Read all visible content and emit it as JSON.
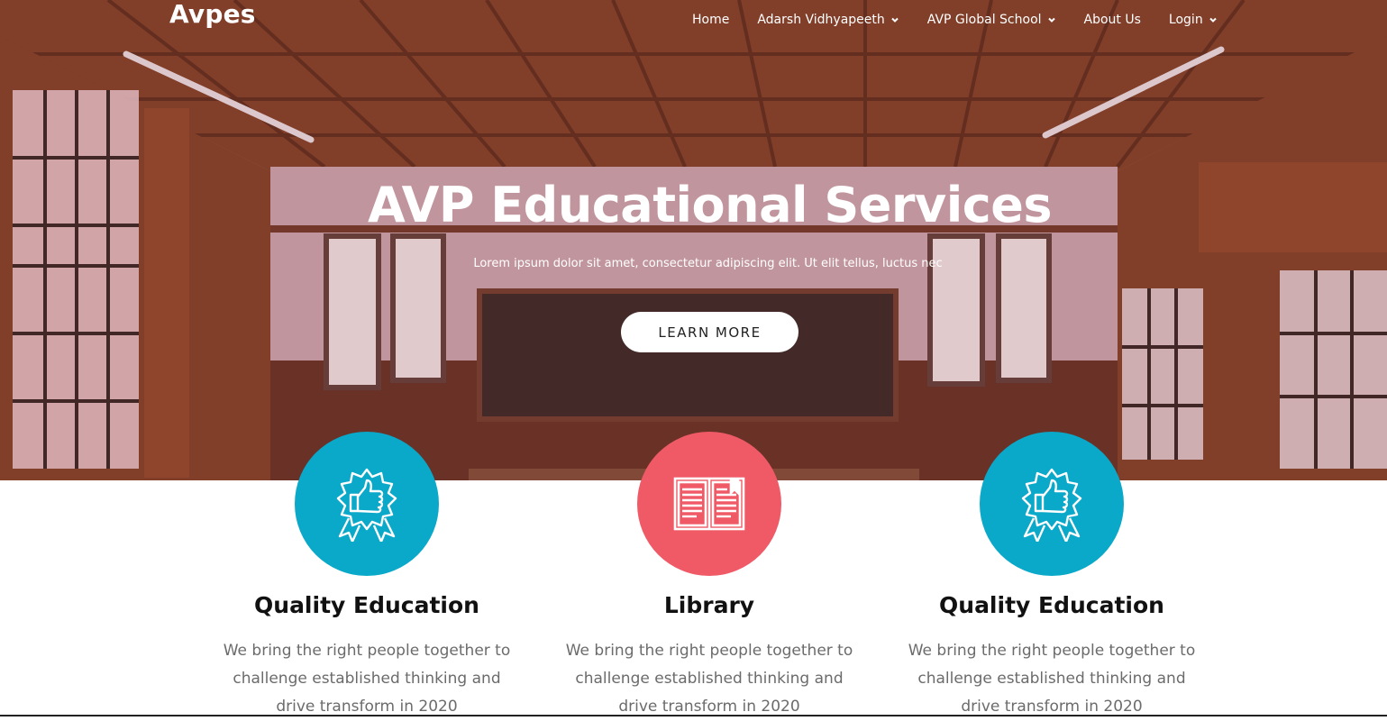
{
  "brand": {
    "name": "Avpes"
  },
  "nav": {
    "items": [
      {
        "label": "Home",
        "has_dropdown": false
      },
      {
        "label": "Adarsh Vidhyapeeth",
        "has_dropdown": true
      },
      {
        "label": "AVP Global School",
        "has_dropdown": true
      },
      {
        "label": "About Us",
        "has_dropdown": false
      },
      {
        "label": "Login",
        "has_dropdown": true
      }
    ]
  },
  "hero": {
    "title": "AVP Educational Services",
    "subtitle": "Lorem ipsum dolor sit amet, consectetur adipiscing elit. Ut elit tellus, luctus nec",
    "cta_label": "LEARN MORE"
  },
  "features": [
    {
      "icon": "thumbs-up-badge-icon",
      "color": "#0aa8c9",
      "title": "Quality Education",
      "text": "We bring the right people together to challenge established thinking and drive transform in 2020"
    },
    {
      "icon": "open-book-icon",
      "color": "#f05a67",
      "title": "Library",
      "text": "We bring the right people together to challenge established thinking and drive transform in 2020"
    },
    {
      "icon": "thumbs-up-badge-icon",
      "color": "#0aa8c9",
      "title": "Quality Education",
      "text": "We bring the right people together to challenge established thinking and drive transform in 2020"
    }
  ]
}
